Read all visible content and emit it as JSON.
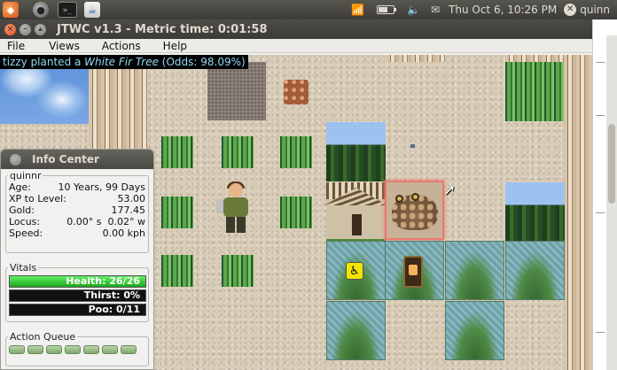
{
  "top_panel": {
    "clock": "Thu Oct  6, 10:26 PM",
    "user": "quinn",
    "battery_level": 0.55
  },
  "window": {
    "title": "JTWC v1.3 - Metric time: 0:01:58",
    "menu": [
      "File",
      "Views",
      "Actions",
      "Help"
    ]
  },
  "game": {
    "message": {
      "player": "tizzy",
      "action": " planted a ",
      "item": "White Fir Tree",
      "odds": " (Odds: 98.09%)"
    }
  },
  "info_center": {
    "title": "Info Center",
    "player_group": "quinnr",
    "stats": [
      {
        "label": "Age:",
        "value": "10 Years, 99 Days"
      },
      {
        "label": "XP to Level:",
        "value": "53.00"
      },
      {
        "label": "Gold:",
        "value": "177.45"
      },
      {
        "label": "Locus:",
        "value": "0.00° s  0.02° w"
      },
      {
        "label": "Speed:",
        "value": "0.00 kph"
      }
    ],
    "vitals_label": "Vitals",
    "vitals": [
      {
        "label": "Health: 26/26",
        "fraction": 1.0
      },
      {
        "label": "Thirst: 0%",
        "fraction": 0
      },
      {
        "label": "Poo: 0/11",
        "fraction": 0
      }
    ],
    "action_queue_label": "Action Queue",
    "action_queue_slots": 7
  }
}
